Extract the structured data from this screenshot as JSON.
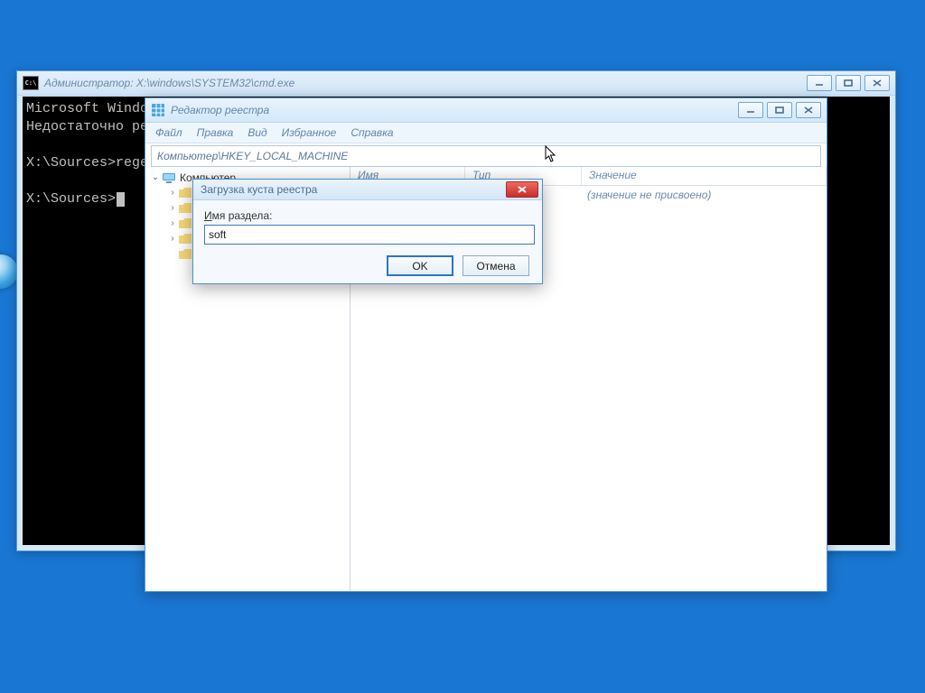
{
  "cmd": {
    "title": "Администратор: X:\\windows\\SYSTEM32\\cmd.exe",
    "line1": "Microsoft Windows",
    "line2": "Недостаточно ресу",
    "line3": "X:\\Sources>regedi",
    "line4": "X:\\Sources>"
  },
  "regedit": {
    "title": "Редактор реестра",
    "menu": {
      "file": "Файл",
      "edit": "Правка",
      "view": "Вид",
      "fav": "Избранное",
      "help": "Справка"
    },
    "address": "Компьютер\\HKEY_LOCAL_MACHINE",
    "root": "Компьютер",
    "col": {
      "name": "Имя",
      "type": "Тип",
      "value": "Значение"
    },
    "novalue": "(значение не присвоено)"
  },
  "dialog": {
    "title": "Загрузка куста реестра",
    "label_char": "И",
    "label_rest": "мя раздела:",
    "input": "soft",
    "ok": "OK",
    "cancel": "Отмена"
  }
}
